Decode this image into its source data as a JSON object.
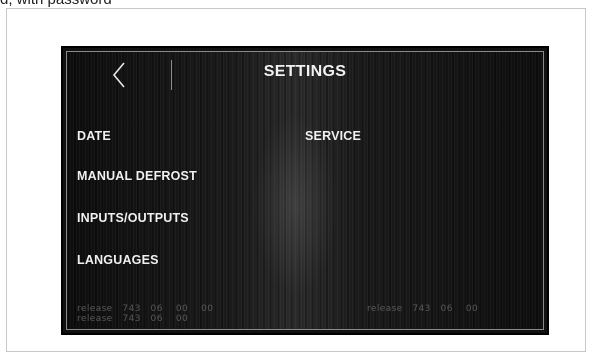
{
  "caption": "d, with password",
  "header": {
    "title": "SETTINGS",
    "back_icon": "chevron-left-icon"
  },
  "menu": {
    "date": "DATE",
    "service": "SERVICE",
    "manual_defrost": "MANUAL DEFROST",
    "inputs_outputs": "INPUTS/OUTPUTS",
    "languages": "LANGUAGES"
  },
  "release": {
    "left_line1": "release   743   06    00    00",
    "left_line2": "release   743   06    00",
    "right_line1": "release   743   06    00"
  },
  "colors": {
    "screen_bg": "#111111",
    "text": "#f0f0f0",
    "release_text": "#595959"
  }
}
